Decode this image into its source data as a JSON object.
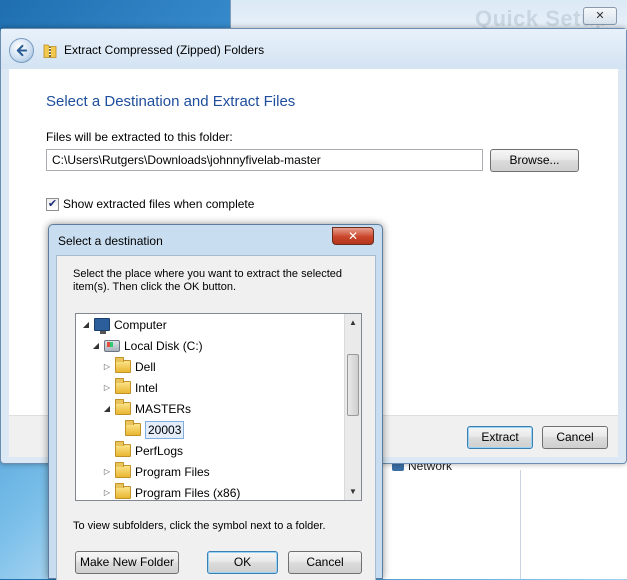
{
  "background": {
    "window_title": "Quick Setup",
    "close_label": "✕",
    "network_label": "Network"
  },
  "wizard": {
    "title": "Extract Compressed (Zipped) Folders",
    "heading": "Select a Destination and Extract Files",
    "path_label": "Files will be extracted to this folder:",
    "path_value": "C:\\Users\\Rutgers\\Downloads\\johnnyfivelab-master",
    "browse_label": "Browse...",
    "show_files_label": "Show extracted files when complete",
    "show_files_checked": true,
    "extract_label": "Extract",
    "cancel_label": "Cancel"
  },
  "dest_dialog": {
    "title": "Select a destination",
    "close_label": "✕",
    "instructions": "Select the place where you want to extract the selected item(s).  Then click the OK button.",
    "hint": "To view subfolders, click the symbol next to a folder.",
    "make_new_folder_label": "Make New Folder",
    "ok_label": "OK",
    "cancel_label": "Cancel",
    "tree": [
      {
        "label": "Computer",
        "icon": "computer-icon",
        "expanded": true
      },
      {
        "label": "Local Disk (C:)",
        "icon": "disk-icon",
        "expanded": true
      },
      {
        "label": "Dell",
        "icon": "folder-icon",
        "expanded": false
      },
      {
        "label": "Intel",
        "icon": "folder-icon",
        "expanded": false
      },
      {
        "label": "MASTERs",
        "icon": "folder-icon",
        "expanded": true
      },
      {
        "label": "20003",
        "icon": "folder-icon",
        "selected": true
      },
      {
        "label": "PerfLogs",
        "icon": "folder-icon"
      },
      {
        "label": "Program Files",
        "icon": "folder-icon",
        "expanded": false
      },
      {
        "label": "Program Files (x86)",
        "icon": "folder-icon",
        "expanded": false
      }
    ]
  }
}
